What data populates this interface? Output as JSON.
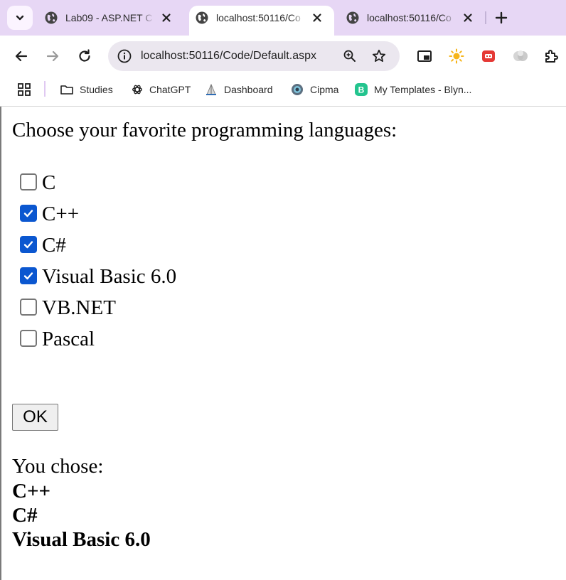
{
  "browser": {
    "tabs": [
      {
        "title": "Lab09 - ASP.NET C",
        "active": false
      },
      {
        "title": "localhost:50116/Co",
        "active": true
      },
      {
        "title": "localhost:50116/Co",
        "active": false
      }
    ],
    "address": {
      "host": "localhost",
      "rest": ":50116/Code/Default.aspx"
    },
    "bookmarks": [
      {
        "label": "Studies",
        "icon": "folder-icon"
      },
      {
        "label": "ChatGPT",
        "icon": "chatgpt-icon"
      },
      {
        "label": "Dashboard",
        "icon": "dashboard-icon"
      },
      {
        "label": "Cipma",
        "icon": "cipma-icon"
      },
      {
        "label": "My Templates - Blyn...",
        "icon": "blynk-icon"
      }
    ],
    "colors": {
      "tabstrip": "#e7d7f5",
      "omnibox": "#ebe7ef",
      "checkbox_checked": "#0b57d0"
    }
  },
  "page": {
    "prompt": "Choose your favorite programming languages:",
    "languages": [
      {
        "label": "C",
        "checked": false
      },
      {
        "label": "C++",
        "checked": true
      },
      {
        "label": "C#",
        "checked": true
      },
      {
        "label": "Visual Basic 6.0",
        "checked": true
      },
      {
        "label": "VB.NET",
        "checked": false
      },
      {
        "label": "Pascal",
        "checked": false
      }
    ],
    "ok_label": "OK",
    "result_label": "You chose:",
    "results": [
      "C++",
      "C#",
      "Visual Basic 6.0"
    ]
  }
}
